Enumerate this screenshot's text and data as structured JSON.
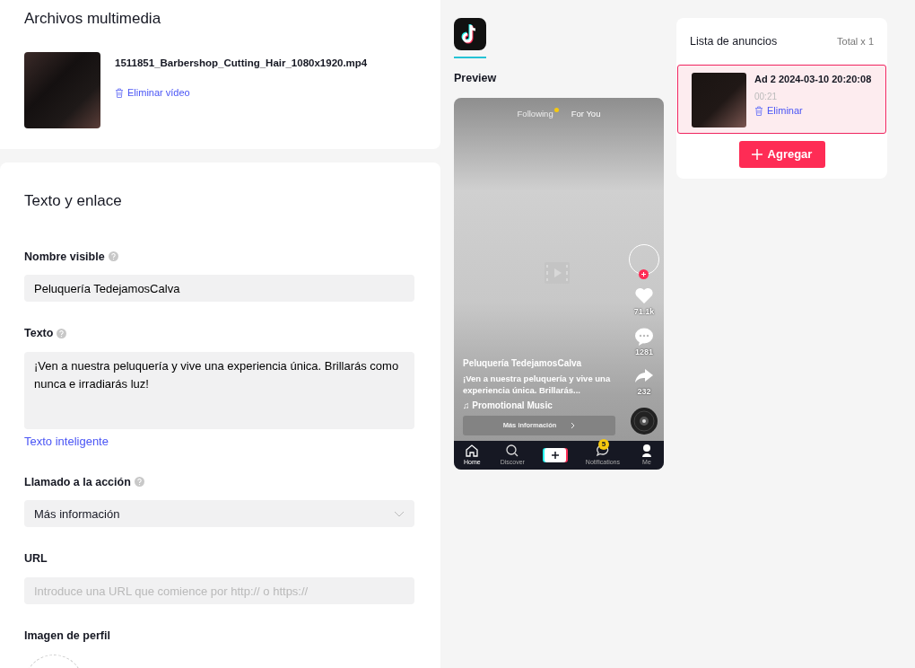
{
  "media": {
    "title": "Archivos multimedia",
    "file_name": "1511851_Barbershop_Cutting_Hair_1080x1920.mp4",
    "delete_label": "Eliminar vídeo"
  },
  "text_section": {
    "title": "Texto y enlace",
    "fields": [
      {
        "kind": "input",
        "label": "Nombre visible",
        "help": true,
        "value": "Peluquería TedejamosCalva"
      },
      {
        "kind": "textarea",
        "label": "Texto",
        "help": true,
        "value": "¡Ven a nuestra peluquería y vive una experiencia única. Brillarás como nunca e irradiarás luz!",
        "link": "Texto inteligente"
      },
      {
        "kind": "select",
        "label": "Llamado a la acción",
        "help": true,
        "value": "Más información"
      },
      {
        "kind": "input",
        "label": "URL",
        "help": false,
        "placeholder": "Introduce una URL que comience por http:// o https://"
      },
      {
        "kind": "avatar",
        "label": "Imagen de perfil",
        "help": false
      }
    ]
  },
  "preview": {
    "label": "Preview",
    "tabs": [
      {
        "label": "Following",
        "selected": false
      },
      {
        "label": "For You",
        "selected": true
      }
    ],
    "actions": [
      {
        "kind": "like",
        "count": "71.1k"
      },
      {
        "kind": "comment",
        "count": "1281"
      },
      {
        "kind": "share",
        "count": "232"
      }
    ],
    "username": "Peluquería TedejamosCalva",
    "caption": "¡Ven a nuestra peluquería y vive una experiencia única. Brillarás...",
    "music": "♫ Promotional Music",
    "cta": "Más información",
    "nav": [
      {
        "kind": "home",
        "label": "Home",
        "selected": true
      },
      {
        "kind": "discover",
        "label": "Discover",
        "selected": false
      },
      {
        "kind": "create"
      },
      {
        "kind": "inbox",
        "label": "Notifications",
        "selected": false,
        "badge": "5"
      },
      {
        "kind": "me",
        "label": "Me",
        "selected": false
      }
    ]
  },
  "ad_list": {
    "title": "Lista de anuncios",
    "total": "Total x 1",
    "ads": [
      {
        "name": "Ad 2 2024-03-10 20:20:08",
        "duration": "00:21",
        "delete_label": "Eliminar",
        "selected": true
      }
    ],
    "add_label": "Agregar"
  }
}
